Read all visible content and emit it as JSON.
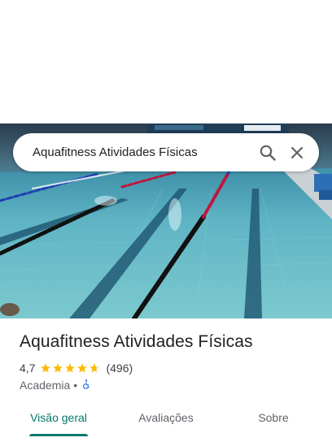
{
  "search": {
    "query": "Aquafitness Atividades Físicas"
  },
  "icons": {
    "search": "search-icon",
    "close": "close-icon",
    "star": "star-icon",
    "accessibility": "wheelchair-accessible-icon"
  },
  "place": {
    "title": "Aquafitness Atividades Físicas",
    "rating": "4,7",
    "stars": 4.7,
    "reviews": "(496)",
    "category": "Academia",
    "separator": "•"
  },
  "tabs": [
    {
      "label": "Visão geral",
      "active": true
    },
    {
      "label": "Avaliações",
      "active": false
    },
    {
      "label": "Sobre",
      "active": false
    }
  ],
  "colors": {
    "accent": "#00796b",
    "star": "#fbbc04",
    "pool": "#5fb9c6",
    "accessible": "#1a73e8"
  }
}
